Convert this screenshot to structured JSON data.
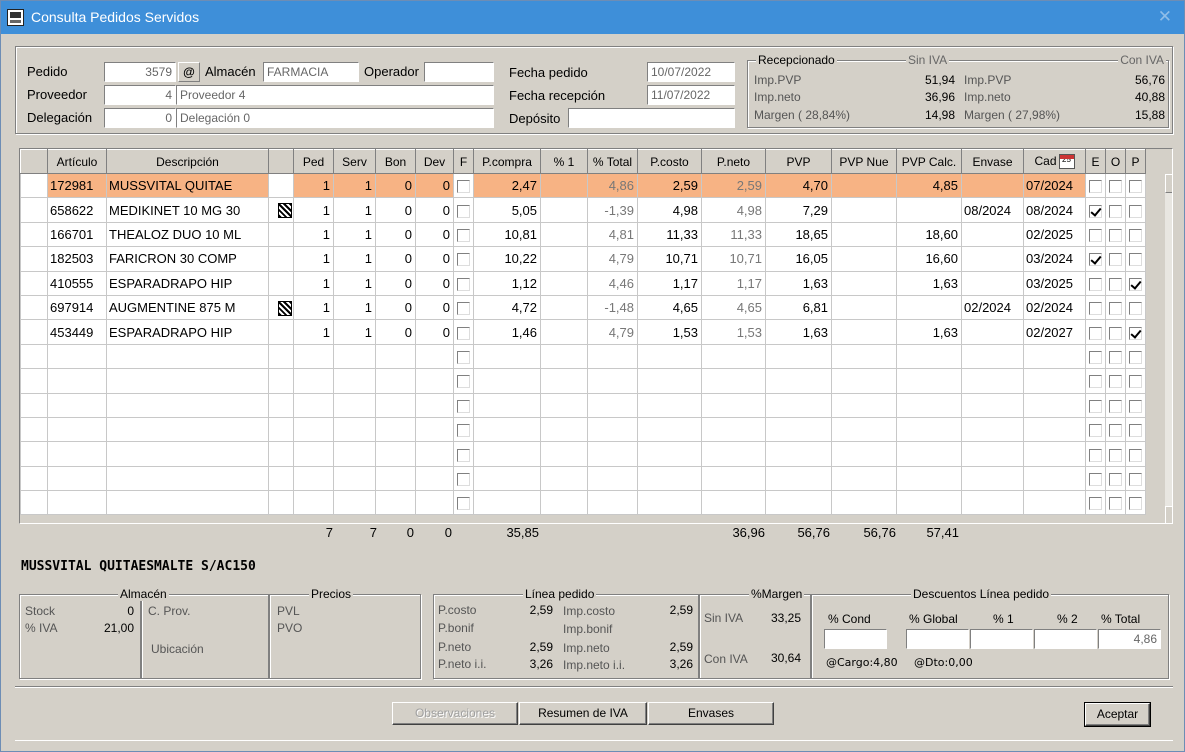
{
  "window": {
    "title": "Consulta Pedidos Servidos",
    "close": "✕"
  },
  "header": {
    "pedido_label": "Pedido",
    "pedido": "3579",
    "at": "@",
    "almacen_label": "Almacén",
    "almacen": "FARMACIA",
    "operador_label": "Operador",
    "operador": "",
    "proveedor_label": "Proveedor",
    "proveedor_code": "4",
    "proveedor_name": "Proveedor 4",
    "delegacion_label": "Delegación",
    "delegacion_code": "0",
    "delegacion_name": "Delegación 0",
    "fecha_pedido_label": "Fecha pedido",
    "fecha_pedido": "10/07/2022",
    "fecha_recepcion_label": "Fecha recepción",
    "fecha_recepcion": "11/07/2022",
    "deposito_label": "Depósito",
    "deposito": ""
  },
  "recepcionado": {
    "title": "Recepcionado",
    "sin_iva_label": "Sin IVA",
    "con_iva_label": "Con IVA",
    "imp_pvp_label": "Imp.PVP",
    "imp_neto_label": "Imp.neto",
    "margen_sin_label": "Margen ( 28,84%)",
    "margen_con_label": "Margen ( 27,98%)",
    "sin_imp_pvp": "51,94",
    "sin_imp_neto": "36,96",
    "sin_margen": "14,98",
    "con_imp_pvp": "56,76",
    "con_imp_neto": "40,88",
    "con_margen": "15,88"
  },
  "grid": {
    "columns": [
      "Artículo",
      "Descripción",
      "",
      "Ped",
      "Serv",
      "Bon",
      "Dev",
      "F",
      "P.compra",
      "% 1",
      "% Total",
      "P.costo",
      "P.neto",
      "PVP",
      "PVP Nue",
      "PVP Calc.",
      "Envase",
      "Cad",
      "E",
      "O",
      "P"
    ],
    "rows": [
      {
        "art": "172981",
        "desc": "MUSSVITAL QUITAE",
        "qr": false,
        "ped": "1",
        "serv": "1",
        "bon": "0",
        "dev": "0",
        "f": false,
        "pcompra": "2,47",
        "p1": "",
        "ptotal": "4,86",
        "pcosto": "2,59",
        "pneto": "2,59",
        "pvp": "4,70",
        "pvpnue": "",
        "pvpcalc": "4,85",
        "envase": "",
        "cad": "07/2024",
        "e": false,
        "o": false,
        "p": false
      },
      {
        "art": "658622",
        "desc": "MEDIKINET 10 MG 30",
        "qr": true,
        "ped": "1",
        "serv": "1",
        "bon": "0",
        "dev": "0",
        "f": false,
        "pcompra": "5,05",
        "p1": "",
        "ptotal": "-1,39",
        "pcosto": "4,98",
        "pneto": "4,98",
        "pvp": "7,29",
        "pvpnue": "",
        "pvpcalc": "",
        "envase": "08/2024",
        "cad": "08/2024",
        "e": true,
        "o": false,
        "p": false
      },
      {
        "art": "166701",
        "desc": "THEALOZ DUO 10 ML",
        "qr": false,
        "ped": "1",
        "serv": "1",
        "bon": "0",
        "dev": "0",
        "f": false,
        "pcompra": "10,81",
        "p1": "",
        "ptotal": "4,81",
        "pcosto": "11,33",
        "pneto": "11,33",
        "pvp": "18,65",
        "pvpnue": "",
        "pvpcalc": "18,60",
        "envase": "",
        "cad": "02/2025",
        "e": false,
        "o": false,
        "p": false
      },
      {
        "art": "182503",
        "desc": "FARICRON  30 COMP",
        "qr": false,
        "ped": "1",
        "serv": "1",
        "bon": "0",
        "dev": "0",
        "f": false,
        "pcompra": "10,22",
        "p1": "",
        "ptotal": "4,79",
        "pcosto": "10,71",
        "pneto": "10,71",
        "pvp": "16,05",
        "pvpnue": "",
        "pvpcalc": "16,60",
        "envase": "",
        "cad": "03/2024",
        "e": true,
        "o": false,
        "p": false
      },
      {
        "art": "410555",
        "desc": "ESPARADRAPO HIP",
        "qr": false,
        "ped": "1",
        "serv": "1",
        "bon": "0",
        "dev": "0",
        "f": false,
        "pcompra": "1,12",
        "p1": "",
        "ptotal": "4,46",
        "pcosto": "1,17",
        "pneto": "1,17",
        "pvp": "1,63",
        "pvpnue": "",
        "pvpcalc": "1,63",
        "envase": "",
        "cad": "03/2025",
        "e": false,
        "o": false,
        "p": true
      },
      {
        "art": "697914",
        "desc": "AUGMENTINE 875 M",
        "qr": true,
        "ped": "1",
        "serv": "1",
        "bon": "0",
        "dev": "0",
        "f": false,
        "pcompra": "4,72",
        "p1": "",
        "ptotal": "-1,48",
        "pcosto": "4,65",
        "pneto": "4,65",
        "pvp": "6,81",
        "pvpnue": "",
        "pvpcalc": "",
        "envase": "02/2024",
        "cad": "02/2024",
        "e": false,
        "o": false,
        "p": false
      },
      {
        "art": "453449",
        "desc": "ESPARADRAPO HIP",
        "qr": false,
        "ped": "1",
        "serv": "1",
        "bon": "0",
        "dev": "0",
        "f": false,
        "pcompra": "1,46",
        "p1": "",
        "ptotal": "4,79",
        "pcosto": "1,53",
        "pneto": "1,53",
        "pvp": "1,63",
        "pvpnue": "",
        "pvpcalc": "1,63",
        "envase": "",
        "cad": "02/2027",
        "e": false,
        "o": false,
        "p": true
      }
    ],
    "empty_rows": 7,
    "totals": {
      "ped": "7",
      "serv": "7",
      "bon": "0",
      "dev": "0",
      "pcompra": "35,85",
      "pneto": "36,96",
      "pvp": "56,76",
      "pvpnue": "56,76",
      "pvpcalc": "57,41"
    }
  },
  "selected_name": "MUSSVITAL QUITAESMALTE S/AC150",
  "almacen_panel": {
    "title": "Almacén",
    "stock_label": "Stock",
    "stock": "0",
    "iva_label": "% IVA",
    "iva": "21,00",
    "cprov_label": "C. Prov.",
    "ubicacion_label": "Ubicación"
  },
  "precios_panel": {
    "title": "Precios",
    "pvl_label": "PVL",
    "pvo_label": "PVO"
  },
  "linea_panel": {
    "title": "Línea pedido",
    "pcosto_label": "P.costo",
    "pcosto": "2,59",
    "pbonif_label": "P.bonif",
    "pneto_label": "P.neto",
    "pneto": "2,59",
    "pnetoii_label": "P.neto i.i.",
    "pnetoii": "3,26",
    "impcosto_label": "Imp.costo",
    "impcosto": "2,59",
    "impbonif_label": "Imp.bonif",
    "impneto_label": "Imp.neto",
    "impneto": "2,59",
    "impnetoii_label": "Imp.neto i.i.",
    "impnetoii": "3,26"
  },
  "margen_panel": {
    "title": "%Margen",
    "sin_label": "Sin IVA",
    "sin": "33,25",
    "con_label": "Con IVA",
    "con": "30,64"
  },
  "descuentos_panel": {
    "title": "Descuentos Línea pedido",
    "cond_label": "% Cond",
    "global_label": "% Global",
    "p1_label": "% 1",
    "p2_label": "% 2",
    "total_label": "% Total",
    "total": "4,86",
    "cargo": "@Cargo:4,80",
    "dto": "@Dto:0,00"
  },
  "buttons": {
    "observaciones": "Observaciones",
    "resumen": "Resumen de IVA",
    "envases": "Envases",
    "aceptar": "Aceptar"
  }
}
